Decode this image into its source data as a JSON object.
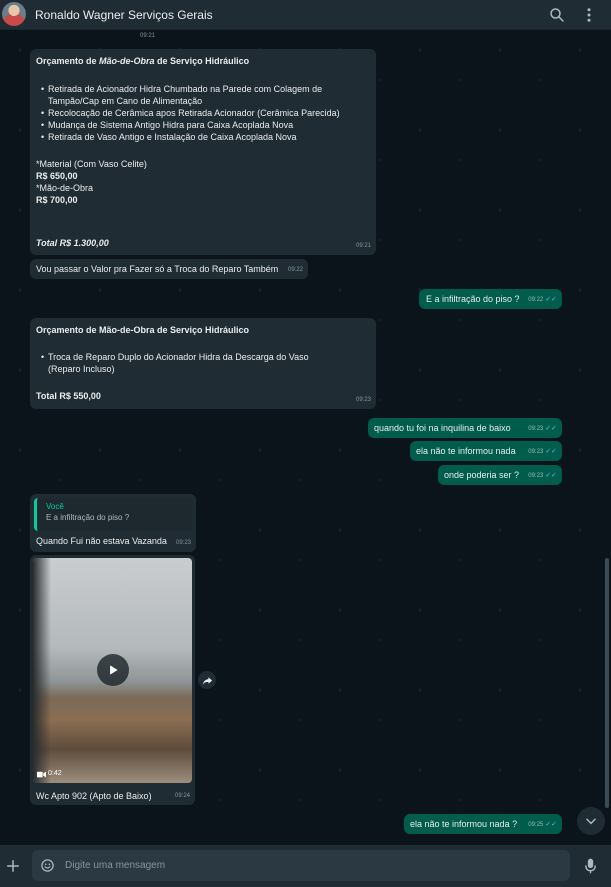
{
  "header": {
    "contact_name": "Ronaldo Wagner Serviços Gerais",
    "icons": [
      "avatar",
      "search-icon",
      "menu-dots-icon"
    ]
  },
  "chat": {
    "top_time_fragment": "09:21",
    "messages": [
      {
        "id": "m1",
        "direction": "in",
        "title_prefix": "Orçamento de ",
        "title_italic": "Mão-de-Obra",
        "title_suffix": " de Serviço Hidráulico",
        "items": [
          "Retirada de Acionador Hidra Chumbado na Parede com Colagem de Tampão/Cap em Cano de Alimentação",
          "Recolocação de Cerâmica apos Retirada Acionador (Cerâmica Parecida)",
          "Mudança de Sistema Antigo Hidra para Caixa Acoplada Nova",
          "Retirada de Vaso Antigo e Instalação de Caixa Acoplada Nova"
        ],
        "line1": "*Material (Com Vaso Celite)",
        "line2": "R$ 650,00",
        "line3": "*Mão-de-Obra",
        "line4": "R$ 700,00",
        "total": "Total R$ 1.300,00",
        "time": "09:21"
      },
      {
        "id": "m2",
        "direction": "in",
        "text": "Vou passar o Valor pra Fazer só a Troca do Reparo Também",
        "time": "09:22"
      },
      {
        "id": "m3",
        "direction": "out",
        "text": "E a infiltração do piso ?",
        "time": "09:22"
      },
      {
        "id": "m4",
        "direction": "in",
        "title": "Orçamento de Mão-de-Obra de Serviço Hidráulico",
        "items": [
          "Troca de Reparo Duplo do Acionador Hidra da Descarga do Vaso (Reparo Incluso)"
        ],
        "total": "Total  R$ 550,00",
        "time": "09:23"
      },
      {
        "id": "m5",
        "direction": "out",
        "text": "quando  tu foi na inquilina de baixo",
        "time": "09:23"
      },
      {
        "id": "m6",
        "direction": "out",
        "text": "ela não te informou nada",
        "time": "09:23"
      },
      {
        "id": "m7",
        "direction": "out",
        "text": "onde poderia ser ?",
        "time": "09:23"
      },
      {
        "id": "m8",
        "direction": "in",
        "quote_author": "Você",
        "quote_text": "E a infiltração do piso ?",
        "text": "Quando Fui não estava Vazanda",
        "time": "09:23"
      },
      {
        "id": "m9",
        "direction": "in",
        "type": "video",
        "duration": "0:42",
        "caption": "Wc Apto 902 (Apto de Baixo)",
        "time": "09:24"
      },
      {
        "id": "m10",
        "direction": "out",
        "text": "ela não te informou nada ?",
        "time": "09:25"
      }
    ]
  },
  "composer": {
    "placeholder": "Digite uma mensagem",
    "value": ""
  },
  "colors": {
    "background": "#0b141a",
    "header": "#202c33",
    "incoming": "#202c33",
    "outgoing": "#005c4b",
    "read_ticks": "#53bdeb",
    "quote_bar": "#06cf9c"
  }
}
